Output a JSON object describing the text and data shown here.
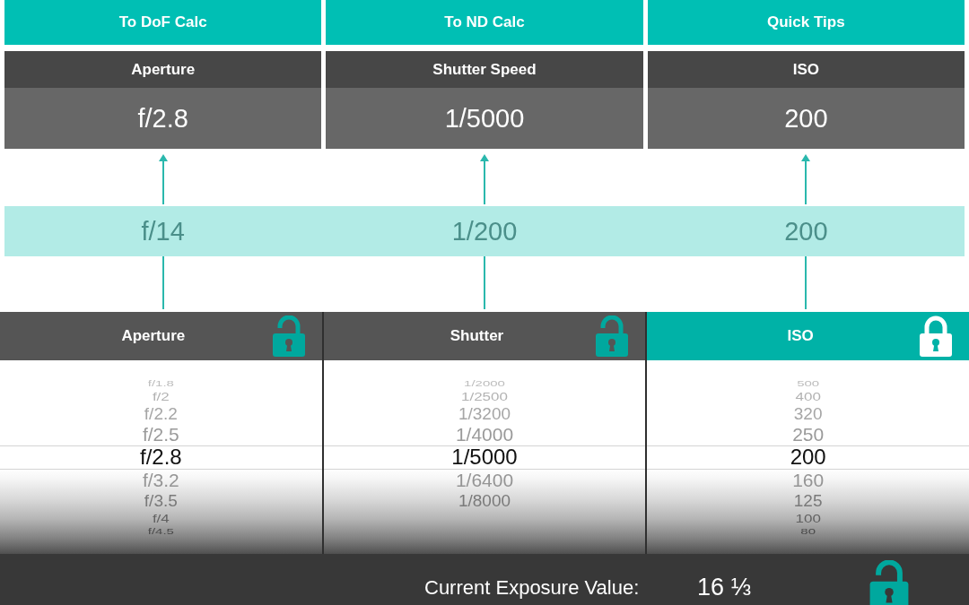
{
  "nav_buttons": [
    "To DoF Calc",
    "To ND Calc",
    "Quick Tips"
  ],
  "results": [
    {
      "label": "Aperture",
      "value": "f/2.8"
    },
    {
      "label": "Shutter Speed",
      "value": "1/5000"
    },
    {
      "label": "ISO",
      "value": "200"
    }
  ],
  "metered": [
    "f/14",
    "1/200",
    "200"
  ],
  "pickers": [
    {
      "title": "Aperture",
      "locked": false,
      "options": [
        {
          "label": "f/1.8",
          "selected": false
        },
        {
          "label": "f/2",
          "selected": false
        },
        {
          "label": "f/2.2",
          "selected": false
        },
        {
          "label": "f/2.5",
          "selected": false
        },
        {
          "label": "f/2.8",
          "selected": true
        },
        {
          "label": "f/3.2",
          "selected": false
        },
        {
          "label": "f/3.5",
          "selected": false
        },
        {
          "label": "f/4",
          "selected": false
        },
        {
          "label": "f/4.5",
          "selected": false
        }
      ]
    },
    {
      "title": "Shutter",
      "locked": false,
      "options": [
        {
          "label": "1/2000",
          "selected": false
        },
        {
          "label": "1/2500",
          "selected": false
        },
        {
          "label": "1/3200",
          "selected": false
        },
        {
          "label": "1/4000",
          "selected": false
        },
        {
          "label": "1/5000",
          "selected": true
        },
        {
          "label": "1/6400",
          "selected": false
        },
        {
          "label": "1/8000",
          "selected": false
        }
      ]
    },
    {
      "title": "ISO",
      "locked": true,
      "options": [
        {
          "label": "500",
          "selected": false
        },
        {
          "label": "400",
          "selected": false
        },
        {
          "label": "320",
          "selected": false
        },
        {
          "label": "250",
          "selected": false
        },
        {
          "label": "200",
          "selected": true
        },
        {
          "label": "160",
          "selected": false
        },
        {
          "label": "125",
          "selected": false
        },
        {
          "label": "100",
          "selected": false
        },
        {
          "label": "80",
          "selected": false
        }
      ]
    }
  ],
  "footer": {
    "label": "Current Exposure Value:",
    "value": "16 ⅓",
    "locked": false
  }
}
